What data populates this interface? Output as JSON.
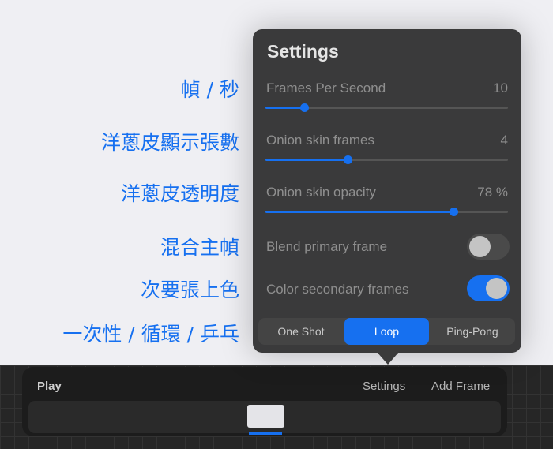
{
  "annotations": [
    "幀 / 秒",
    "洋蔥皮顯示張數",
    "洋蔥皮透明度",
    "混合主幀",
    "次要張上色",
    "一次性 / 循環 / 乒乓"
  ],
  "settings": {
    "title": "Settings",
    "sliders": [
      {
        "label": "Frames Per Second",
        "value": "10",
        "fraction": 0.16
      },
      {
        "label": "Onion skin frames",
        "value": "4",
        "fraction": 0.34
      },
      {
        "label": "Onion skin opacity",
        "value": "78 %",
        "fraction": 0.775
      }
    ],
    "toggles": [
      {
        "label": "Blend primary frame",
        "on": false
      },
      {
        "label": "Color secondary frames",
        "on": true
      }
    ],
    "modes": [
      "One Shot",
      "Loop",
      "Ping-Pong"
    ],
    "selected_mode": "Loop"
  },
  "toolbar": {
    "play": "Play",
    "settings": "Settings",
    "add_frame": "Add Frame"
  },
  "colors": {
    "accent": "#1670f0",
    "popover": "#3a3a3b"
  }
}
